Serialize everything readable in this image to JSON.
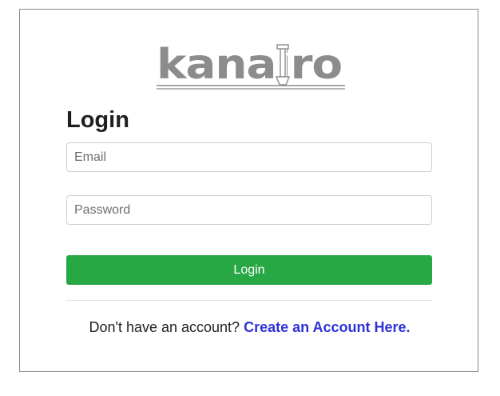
{
  "brand": {
    "logo_text": "kanairo",
    "logo_color": "#8c8c8c"
  },
  "form": {
    "title": "Login",
    "email_placeholder": "Email",
    "email_value": "",
    "password_placeholder": "Password",
    "password_value": "",
    "submit_label": "Login",
    "submit_color": "#28a745"
  },
  "footer": {
    "prompt_text": "Don't have an account?",
    "signup_link_text": "Create an Account Here.",
    "link_color": "#2f31d8"
  }
}
